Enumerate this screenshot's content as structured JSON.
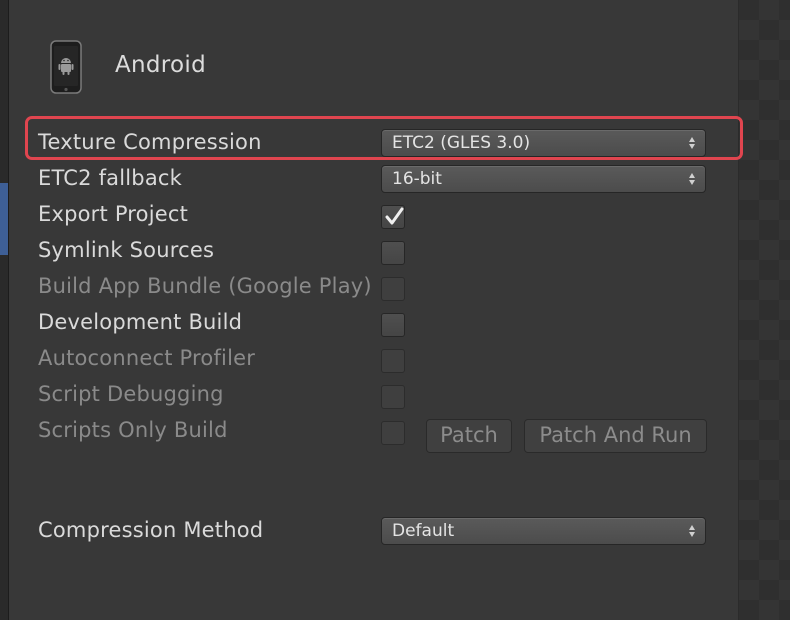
{
  "platform": {
    "title": "Android",
    "icon": "android-phone-icon"
  },
  "settings": {
    "texture_compression": {
      "label": "Texture Compression",
      "value": "ETC2 (GLES 3.0)"
    },
    "etc2_fallback": {
      "label": "ETC2 fallback",
      "value": "16-bit"
    },
    "export_project": {
      "label": "Export Project",
      "checked": true
    },
    "symlink_sources": {
      "label": "Symlink Sources",
      "checked": false
    },
    "build_app_bundle": {
      "label": "Build App Bundle (Google Play)",
      "checked": false,
      "enabled": false
    },
    "development_build": {
      "label": "Development Build",
      "checked": false
    },
    "autoconnect_profiler": {
      "label": "Autoconnect Profiler",
      "checked": false,
      "enabled": false
    },
    "script_debugging": {
      "label": "Script Debugging",
      "checked": false,
      "enabled": false
    },
    "scripts_only_build": {
      "label": "Scripts Only Build",
      "checked": false,
      "enabled": false
    },
    "compression_method": {
      "label": "Compression Method",
      "value": "Default"
    }
  },
  "buttons": {
    "patch": "Patch",
    "patch_and_run": "Patch And Run"
  },
  "colors": {
    "background": "#383838",
    "highlight": "#e0454f",
    "text": "#dadada",
    "disabled_text": "#8a8a8a"
  }
}
